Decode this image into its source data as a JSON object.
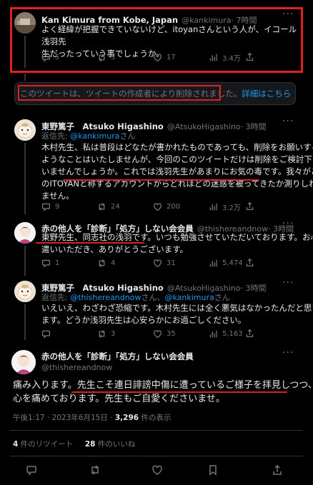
{
  "tweet1": {
    "author": "Kan Kimura from Kobe, Japan",
    "handle": "@kankimura",
    "time": "· 7時間",
    "text_line1": "よく経緯が把握できていないけど、itoyanさんという人が、イコール浅羽先",
    "text_line2": "生だったっていう事でしょうか。",
    "replies": "5",
    "retweets": "3",
    "likes": "17",
    "views": "3.4万"
  },
  "deleted_notice": {
    "text": "このツイートは、ツイートの作成者により削除されました。",
    "link": "詳細はこちら"
  },
  "tweet2": {
    "author": "東野篤子　Atsuko Higashino",
    "handle": "@AtsukoHigashino",
    "time": "· 3時間",
    "reply_prefix": "返信先: ",
    "reply_to": "@kankimura",
    "reply_suffix": "さん",
    "lines": [
      "木村先生、私は普段はどなたが書かれたものであっても、削除をお願いする",
      "ようなことはいたしませんが、今回のこのツイートだけは削除をご検討下さ",
      "いませんでしょうか。これでは浅羽先生があまりにお気の毒です。我々がこ",
      "のITOYANと称するアカウントからどれほどの迷惑を被ってきたか測りしれ",
      "ません。"
    ],
    "replies": "9",
    "retweets": "24",
    "likes": "200",
    "views": "3.2万"
  },
  "tweet3": {
    "author": "赤の他人を「診断」「処方」しない会会員",
    "handle": "@thishereandnow",
    "time": "· 3時間",
    "lines": [
      "東野先生、同志社の浅羽です。いつも勉強させていただいております。お心",
      "遣いいただき、ありがとうございます。"
    ],
    "replies": "1",
    "retweets": "4",
    "likes": "31",
    "views": "5,474"
  },
  "tweet4": {
    "author": "東野篤子　Atsuko Higashino",
    "handle": "@AtsukoHigashino",
    "time": "· 3時間",
    "reply_prefix": "返信先: ",
    "reply_to": "@thishereandnow",
    "reply_mid": "さん、",
    "reply_to2": "@kankimura",
    "reply_suffix": "さん",
    "lines": [
      "いえいえ、わざわざ恐縮です。木村先生には全く悪気はなかったんだと思い",
      "ます。どうか浅羽先生は心安らかにお過ごしください。"
    ],
    "replies": "",
    "retweets": "3",
    "likes": "35",
    "views": "5,163"
  },
  "main_tweet": {
    "author": "赤の他人を「診断」「処方」しない会会員",
    "handle": "@thishereandnow",
    "line1": "痛み入ります。先生こそ連日誹謗中傷に遭っているご様子を拝見しつつ、",
    "line2": "心を痛めております。先生もご自愛くださいませ。",
    "timestamp": "午後1:17 · 2023年6月15日 · ",
    "views_count": "3,296",
    "views_label": " 件の表示",
    "retweet_count": "4",
    "retweet_label": " 件のリツイート",
    "like_count": "28",
    "like_label": " 件のいいね"
  },
  "colors": {
    "background": "#000000",
    "text": "#e7e9ea",
    "muted": "#71767b",
    "link": "#1d9bf0",
    "annotation": "#e01f1f"
  }
}
